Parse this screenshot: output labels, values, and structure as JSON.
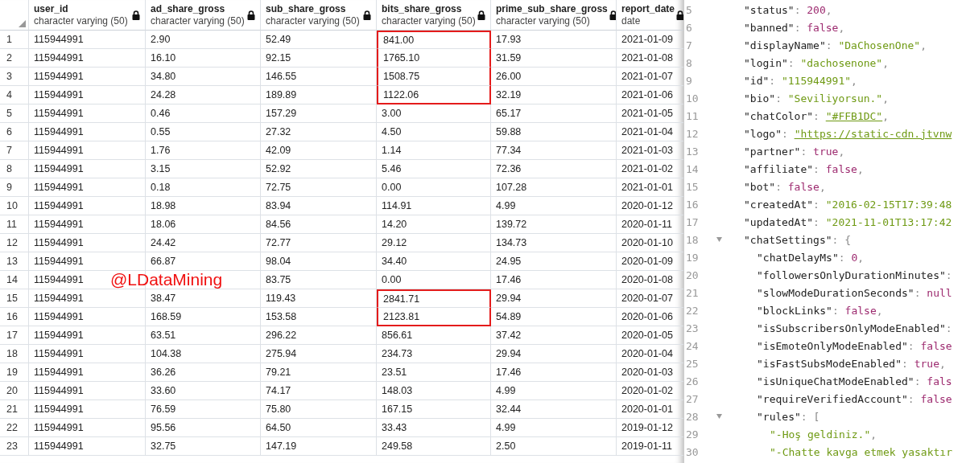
{
  "table": {
    "columns": [
      {
        "name": "user_id",
        "type": "character varying (50)",
        "locked": true
      },
      {
        "name": "ad_share_gross",
        "type": "character varying (50)",
        "locked": true
      },
      {
        "name": "sub_share_gross",
        "type": "character varying (50)",
        "locked": true
      },
      {
        "name": "bits_share_gross",
        "type": "character varying (50)",
        "locked": true
      },
      {
        "name": "prime_sub_share_gross",
        "type": "character varying (50)",
        "locked": true
      },
      {
        "name": "report_date",
        "type": "date",
        "locked": true
      }
    ],
    "rows": [
      {
        "number": "1",
        "cells": [
          "115944991",
          "2.90",
          "52.49",
          "841.00",
          "17.93",
          "2021-01-09"
        ],
        "boxed": true
      },
      {
        "number": "2",
        "cells": [
          "115944991",
          "16.10",
          "92.15",
          "1765.10",
          "31.59",
          "2021-01-08"
        ],
        "boxed": true
      },
      {
        "number": "3",
        "cells": [
          "115944991",
          "34.80",
          "146.55",
          "1508.75",
          "26.00",
          "2021-01-07"
        ],
        "boxed": true
      },
      {
        "number": "4",
        "cells": [
          "115944991",
          "24.28",
          "189.89",
          "1122.06",
          "32.19",
          "2021-01-06"
        ],
        "boxed": true
      },
      {
        "number": "5",
        "cells": [
          "115944991",
          "0.46",
          "157.29",
          "3.00",
          "65.17",
          "2021-01-05"
        ],
        "boxed": false
      },
      {
        "number": "6",
        "cells": [
          "115944991",
          "0.55",
          "27.32",
          "4.50",
          "59.88",
          "2021-01-04"
        ],
        "boxed": false
      },
      {
        "number": "7",
        "cells": [
          "115944991",
          "1.76",
          "42.09",
          "1.14",
          "77.34",
          "2021-01-03"
        ],
        "boxed": false
      },
      {
        "number": "8",
        "cells": [
          "115944991",
          "3.15",
          "52.92",
          "5.46",
          "72.36",
          "2021-01-02"
        ],
        "boxed": false
      },
      {
        "number": "9",
        "cells": [
          "115944991",
          "0.18",
          "72.75",
          "0.00",
          "107.28",
          "2021-01-01"
        ],
        "boxed": false
      },
      {
        "number": "10",
        "cells": [
          "115944991",
          "18.98",
          "83.94",
          "114.91",
          "4.99",
          "2020-01-12"
        ],
        "boxed": false
      },
      {
        "number": "11",
        "cells": [
          "115944991",
          "18.06",
          "84.56",
          "14.20",
          "139.72",
          "2020-01-11"
        ],
        "boxed": false
      },
      {
        "number": "12",
        "cells": [
          "115944991",
          "24.42",
          "72.77",
          "29.12",
          "134.73",
          "2020-01-10"
        ],
        "boxed": false
      },
      {
        "number": "13",
        "cells": [
          "115944991",
          "66.87",
          "98.04",
          "34.40",
          "24.95",
          "2020-01-09"
        ],
        "boxed": false
      },
      {
        "number": "14",
        "cells": [
          "115944991",
          null,
          "83.75",
          "0.00",
          "17.46",
          "2020-01-08"
        ],
        "boxed": false
      },
      {
        "number": "15",
        "cells": [
          "115944991",
          "38.47",
          "119.43",
          "2841.71",
          "29.94",
          "2020-01-07"
        ],
        "boxed": true
      },
      {
        "number": "16",
        "cells": [
          "115944991",
          "168.59",
          "153.58",
          "2123.81",
          "54.89",
          "2020-01-06"
        ],
        "boxed": true
      },
      {
        "number": "17",
        "cells": [
          "115944991",
          "63.51",
          "296.22",
          "856.61",
          "37.42",
          "2020-01-05"
        ],
        "boxed": false
      },
      {
        "number": "18",
        "cells": [
          "115944991",
          "104.38",
          "275.94",
          "234.73",
          "29.94",
          "2020-01-04"
        ],
        "boxed": false
      },
      {
        "number": "19",
        "cells": [
          "115944991",
          "36.26",
          "79.21",
          "23.51",
          "17.46",
          "2020-01-03"
        ],
        "boxed": false
      },
      {
        "number": "20",
        "cells": [
          "115944991",
          "33.60",
          "74.17",
          "148.03",
          "4.99",
          "2020-01-02"
        ],
        "boxed": false
      },
      {
        "number": "21",
        "cells": [
          "115944991",
          "76.59",
          "75.80",
          "167.15",
          "32.44",
          "2020-01-01"
        ],
        "boxed": false
      },
      {
        "number": "22",
        "cells": [
          "115944991",
          "95.56",
          "64.50",
          "33.43",
          "4.99",
          "2019-01-12"
        ],
        "boxed": false
      },
      {
        "number": "23",
        "cells": [
          "115944991",
          "32.75",
          "147.19",
          "249.58",
          "2.50",
          "2019-01-11"
        ],
        "boxed": false
      }
    ],
    "overlay_text": "@LDataMining"
  },
  "editor": {
    "lines": [
      {
        "number": "5",
        "tokens": [
          {
            "kind": "key",
            "text": "\"status\""
          },
          {
            "kind": "punct",
            "text": ": "
          },
          {
            "kind": "literal",
            "text": "200"
          },
          {
            "kind": "punct",
            "text": ","
          }
        ]
      },
      {
        "number": "6",
        "tokens": [
          {
            "kind": "key",
            "text": "\"banned\""
          },
          {
            "kind": "punct",
            "text": ": "
          },
          {
            "kind": "literal",
            "text": "false"
          },
          {
            "kind": "punct",
            "text": ","
          }
        ]
      },
      {
        "number": "7",
        "tokens": [
          {
            "kind": "key",
            "text": "\"displayName\""
          },
          {
            "kind": "punct",
            "text": ": "
          },
          {
            "kind": "string",
            "text": "\"DaChosenOne\""
          },
          {
            "kind": "punct",
            "text": ","
          }
        ]
      },
      {
        "number": "8",
        "tokens": [
          {
            "kind": "key",
            "text": "\"login\""
          },
          {
            "kind": "punct",
            "text": ": "
          },
          {
            "kind": "string",
            "text": "\"dachosenone\""
          },
          {
            "kind": "punct",
            "text": ","
          }
        ]
      },
      {
        "number": "9",
        "tokens": [
          {
            "kind": "key",
            "text": "\"id\""
          },
          {
            "kind": "punct",
            "text": ": "
          },
          {
            "kind": "string",
            "text": "\"115944991\""
          },
          {
            "kind": "punct",
            "text": ","
          }
        ]
      },
      {
        "number": "10",
        "tokens": [
          {
            "kind": "key",
            "text": "\"bio\""
          },
          {
            "kind": "punct",
            "text": ": "
          },
          {
            "kind": "string",
            "text": "\"Seviliyorsun.\""
          },
          {
            "kind": "punct",
            "text": ","
          }
        ]
      },
      {
        "number": "11",
        "tokens": [
          {
            "kind": "key",
            "text": "\"chatColor\""
          },
          {
            "kind": "punct",
            "text": ": "
          },
          {
            "kind": "link",
            "text": "\"#FFB1DC\""
          },
          {
            "kind": "punct",
            "text": ","
          }
        ]
      },
      {
        "number": "12",
        "tokens": [
          {
            "kind": "key",
            "text": "\"logo\""
          },
          {
            "kind": "punct",
            "text": ": "
          },
          {
            "kind": "link",
            "text": "\"https://static-cdn.jtvnw"
          }
        ]
      },
      {
        "number": "13",
        "tokens": [
          {
            "kind": "key",
            "text": "\"partner\""
          },
          {
            "kind": "punct",
            "text": ": "
          },
          {
            "kind": "literal",
            "text": "true"
          },
          {
            "kind": "punct",
            "text": ","
          }
        ]
      },
      {
        "number": "14",
        "tokens": [
          {
            "kind": "key",
            "text": "\"affiliate\""
          },
          {
            "kind": "punct",
            "text": ": "
          },
          {
            "kind": "literal",
            "text": "false"
          },
          {
            "kind": "punct",
            "text": ","
          }
        ]
      },
      {
        "number": "15",
        "tokens": [
          {
            "kind": "key",
            "text": "\"bot\""
          },
          {
            "kind": "punct",
            "text": ": "
          },
          {
            "kind": "literal",
            "text": "false"
          },
          {
            "kind": "punct",
            "text": ","
          }
        ]
      },
      {
        "number": "16",
        "tokens": [
          {
            "kind": "key",
            "text": "\"createdAt\""
          },
          {
            "kind": "punct",
            "text": ": "
          },
          {
            "kind": "string",
            "text": "\"2016-02-15T17:39:48"
          }
        ]
      },
      {
        "number": "17",
        "tokens": [
          {
            "kind": "key",
            "text": "\"updatedAt\""
          },
          {
            "kind": "punct",
            "text": ": "
          },
          {
            "kind": "string",
            "text": "\"2021-11-01T13:17:42"
          }
        ]
      },
      {
        "number": "18",
        "expanded": true,
        "tokens": [
          {
            "kind": "key",
            "text": "\"chatSettings\""
          },
          {
            "kind": "punct",
            "text": ": {"
          }
        ],
        "children": [
          {
            "number": "19",
            "tokens": [
              {
                "kind": "key",
                "text": "\"chatDelayMs\""
              },
              {
                "kind": "punct",
                "text": ": "
              },
              {
                "kind": "literal",
                "text": "0"
              },
              {
                "kind": "punct",
                "text": ","
              }
            ]
          },
          {
            "number": "20",
            "tokens": [
              {
                "kind": "key",
                "text": "\"followersOnlyDurationMinutes\""
              },
              {
                "kind": "punct",
                "text": ":"
              }
            ]
          },
          {
            "number": "21",
            "tokens": [
              {
                "kind": "key",
                "text": "\"slowModeDurationSeconds\""
              },
              {
                "kind": "punct",
                "text": ": "
              },
              {
                "kind": "literal",
                "text": "null"
              }
            ]
          },
          {
            "number": "22",
            "tokens": [
              {
                "kind": "key",
                "text": "\"blockLinks\""
              },
              {
                "kind": "punct",
                "text": ": "
              },
              {
                "kind": "literal",
                "text": "false"
              },
              {
                "kind": "punct",
                "text": ","
              }
            ]
          },
          {
            "number": "23",
            "tokens": [
              {
                "kind": "key",
                "text": "\"isSubscribersOnlyModeEnabled\""
              },
              {
                "kind": "punct",
                "text": ":"
              }
            ]
          },
          {
            "number": "24",
            "tokens": [
              {
                "kind": "key",
                "text": "\"isEmoteOnlyModeEnabled\""
              },
              {
                "kind": "punct",
                "text": ": "
              },
              {
                "kind": "literal",
                "text": "false"
              }
            ]
          },
          {
            "number": "25",
            "tokens": [
              {
                "kind": "key",
                "text": "\"isFastSubsModeEnabled\""
              },
              {
                "kind": "punct",
                "text": ": "
              },
              {
                "kind": "literal",
                "text": "true"
              },
              {
                "kind": "punct",
                "text": ","
              }
            ]
          },
          {
            "number": "26",
            "tokens": [
              {
                "kind": "key",
                "text": "\"isUniqueChatModeEnabled\""
              },
              {
                "kind": "punct",
                "text": ": "
              },
              {
                "kind": "literal",
                "text": "fals"
              }
            ]
          },
          {
            "number": "27",
            "tokens": [
              {
                "kind": "key",
                "text": "\"requireVerifiedAccount\""
              },
              {
                "kind": "punct",
                "text": ": "
              },
              {
                "kind": "literal",
                "text": "false"
              }
            ]
          },
          {
            "number": "28",
            "expanded": true,
            "tokens": [
              {
                "kind": "key",
                "text": "\"rules\""
              },
              {
                "kind": "punct",
                "text": ": ["
              }
            ],
            "children": [
              {
                "number": "29",
                "tokens": [
                  {
                    "kind": "string",
                    "text": "\"-Hoş geldiniz.\""
                  },
                  {
                    "kind": "punct",
                    "text": ","
                  }
                ]
              },
              {
                "number": "30",
                "tokens": [
                  {
                    "kind": "string",
                    "text": "\"-Chatte kavga etmek yasaktır"
                  }
                ]
              }
            ]
          }
        ]
      }
    ]
  }
}
